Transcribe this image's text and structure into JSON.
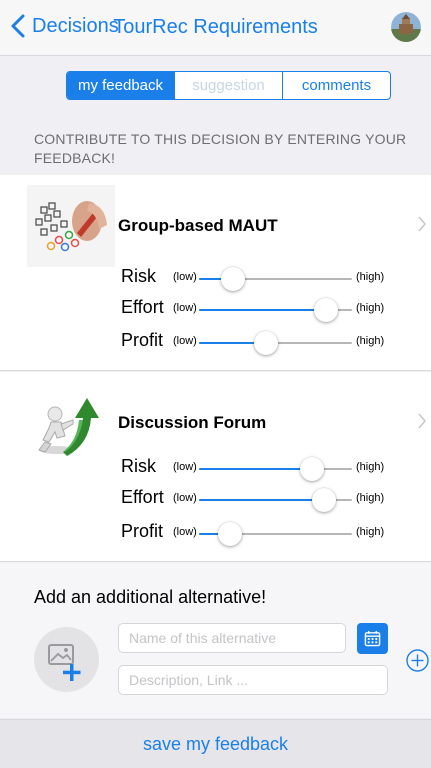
{
  "nav": {
    "back_label": "Decisions",
    "title": "TourRec Requirements",
    "back_icon": "chevron-left-icon",
    "avatar_icon": "avatar"
  },
  "segments": [
    {
      "label": "my feedback",
      "state": "active"
    },
    {
      "label": "suggestion",
      "state": "disabled"
    },
    {
      "label": "comments",
      "state": "normal"
    }
  ],
  "section_caption": "CONTRIBUTE TO THIS DECISION BY ENTERING YOUR FEEDBACK!",
  "decisions": [
    {
      "title": "Group-based MAUT",
      "thumb_icon": "checklist-image",
      "sliders": [
        {
          "label": "Risk",
          "low": "(low)",
          "high": "(high)",
          "value": 0.22
        },
        {
          "label": "Effort",
          "low": "(low)",
          "high": "(high)",
          "value": 0.83
        },
        {
          "label": "Profit",
          "low": "(low)",
          "high": "(high)",
          "value": 0.44
        }
      ]
    },
    {
      "title": "Discussion Forum",
      "thumb_icon": "growth-arrow-image",
      "sliders": [
        {
          "label": "Risk",
          "low": "(low)",
          "high": "(high)",
          "value": 0.74
        },
        {
          "label": "Effort",
          "low": "(low)",
          "high": "(high)",
          "value": 0.82
        },
        {
          "label": "Profit",
          "low": "(low)",
          "high": "(high)",
          "value": 0.2
        }
      ]
    }
  ],
  "add_alternative": {
    "title": "Add an additional alternative!",
    "name_placeholder": "Name of this alternative",
    "description_placeholder": "Description, Link ...",
    "image_icon": "add-image-icon",
    "calendar_icon": "calendar-icon",
    "add_icon": "plus-circle-icon"
  },
  "bottom": {
    "save_label": "save my feedback"
  },
  "colors": {
    "accent": "#1a7fe8",
    "background": "#efeff4",
    "track": "#b6b6b6"
  }
}
